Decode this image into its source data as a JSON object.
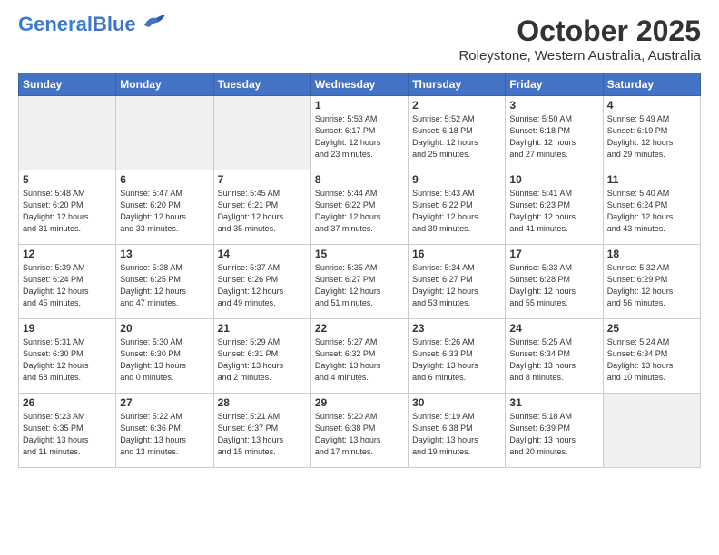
{
  "header": {
    "logo_general": "General",
    "logo_blue": "Blue",
    "month_title": "October 2025",
    "location": "Roleystone, Western Australia, Australia"
  },
  "calendar": {
    "days_of_week": [
      "Sunday",
      "Monday",
      "Tuesday",
      "Wednesday",
      "Thursday",
      "Friday",
      "Saturday"
    ],
    "weeks": [
      [
        {
          "day": "",
          "info": ""
        },
        {
          "day": "",
          "info": ""
        },
        {
          "day": "",
          "info": ""
        },
        {
          "day": "1",
          "info": "Sunrise: 5:53 AM\nSunset: 6:17 PM\nDaylight: 12 hours\nand 23 minutes."
        },
        {
          "day": "2",
          "info": "Sunrise: 5:52 AM\nSunset: 6:18 PM\nDaylight: 12 hours\nand 25 minutes."
        },
        {
          "day": "3",
          "info": "Sunrise: 5:50 AM\nSunset: 6:18 PM\nDaylight: 12 hours\nand 27 minutes."
        },
        {
          "day": "4",
          "info": "Sunrise: 5:49 AM\nSunset: 6:19 PM\nDaylight: 12 hours\nand 29 minutes."
        }
      ],
      [
        {
          "day": "5",
          "info": "Sunrise: 5:48 AM\nSunset: 6:20 PM\nDaylight: 12 hours\nand 31 minutes."
        },
        {
          "day": "6",
          "info": "Sunrise: 5:47 AM\nSunset: 6:20 PM\nDaylight: 12 hours\nand 33 minutes."
        },
        {
          "day": "7",
          "info": "Sunrise: 5:45 AM\nSunset: 6:21 PM\nDaylight: 12 hours\nand 35 minutes."
        },
        {
          "day": "8",
          "info": "Sunrise: 5:44 AM\nSunset: 6:22 PM\nDaylight: 12 hours\nand 37 minutes."
        },
        {
          "day": "9",
          "info": "Sunrise: 5:43 AM\nSunset: 6:22 PM\nDaylight: 12 hours\nand 39 minutes."
        },
        {
          "day": "10",
          "info": "Sunrise: 5:41 AM\nSunset: 6:23 PM\nDaylight: 12 hours\nand 41 minutes."
        },
        {
          "day": "11",
          "info": "Sunrise: 5:40 AM\nSunset: 6:24 PM\nDaylight: 12 hours\nand 43 minutes."
        }
      ],
      [
        {
          "day": "12",
          "info": "Sunrise: 5:39 AM\nSunset: 6:24 PM\nDaylight: 12 hours\nand 45 minutes."
        },
        {
          "day": "13",
          "info": "Sunrise: 5:38 AM\nSunset: 6:25 PM\nDaylight: 12 hours\nand 47 minutes."
        },
        {
          "day": "14",
          "info": "Sunrise: 5:37 AM\nSunset: 6:26 PM\nDaylight: 12 hours\nand 49 minutes."
        },
        {
          "day": "15",
          "info": "Sunrise: 5:35 AM\nSunset: 6:27 PM\nDaylight: 12 hours\nand 51 minutes."
        },
        {
          "day": "16",
          "info": "Sunrise: 5:34 AM\nSunset: 6:27 PM\nDaylight: 12 hours\nand 53 minutes."
        },
        {
          "day": "17",
          "info": "Sunrise: 5:33 AM\nSunset: 6:28 PM\nDaylight: 12 hours\nand 55 minutes."
        },
        {
          "day": "18",
          "info": "Sunrise: 5:32 AM\nSunset: 6:29 PM\nDaylight: 12 hours\nand 56 minutes."
        }
      ],
      [
        {
          "day": "19",
          "info": "Sunrise: 5:31 AM\nSunset: 6:30 PM\nDaylight: 12 hours\nand 58 minutes."
        },
        {
          "day": "20",
          "info": "Sunrise: 5:30 AM\nSunset: 6:30 PM\nDaylight: 13 hours\nand 0 minutes."
        },
        {
          "day": "21",
          "info": "Sunrise: 5:29 AM\nSunset: 6:31 PM\nDaylight: 13 hours\nand 2 minutes."
        },
        {
          "day": "22",
          "info": "Sunrise: 5:27 AM\nSunset: 6:32 PM\nDaylight: 13 hours\nand 4 minutes."
        },
        {
          "day": "23",
          "info": "Sunrise: 5:26 AM\nSunset: 6:33 PM\nDaylight: 13 hours\nand 6 minutes."
        },
        {
          "day": "24",
          "info": "Sunrise: 5:25 AM\nSunset: 6:34 PM\nDaylight: 13 hours\nand 8 minutes."
        },
        {
          "day": "25",
          "info": "Sunrise: 5:24 AM\nSunset: 6:34 PM\nDaylight: 13 hours\nand 10 minutes."
        }
      ],
      [
        {
          "day": "26",
          "info": "Sunrise: 5:23 AM\nSunset: 6:35 PM\nDaylight: 13 hours\nand 11 minutes."
        },
        {
          "day": "27",
          "info": "Sunrise: 5:22 AM\nSunset: 6:36 PM\nDaylight: 13 hours\nand 13 minutes."
        },
        {
          "day": "28",
          "info": "Sunrise: 5:21 AM\nSunset: 6:37 PM\nDaylight: 13 hours\nand 15 minutes."
        },
        {
          "day": "29",
          "info": "Sunrise: 5:20 AM\nSunset: 6:38 PM\nDaylight: 13 hours\nand 17 minutes."
        },
        {
          "day": "30",
          "info": "Sunrise: 5:19 AM\nSunset: 6:38 PM\nDaylight: 13 hours\nand 19 minutes."
        },
        {
          "day": "31",
          "info": "Sunrise: 5:18 AM\nSunset: 6:39 PM\nDaylight: 13 hours\nand 20 minutes."
        },
        {
          "day": "",
          "info": ""
        }
      ]
    ]
  }
}
